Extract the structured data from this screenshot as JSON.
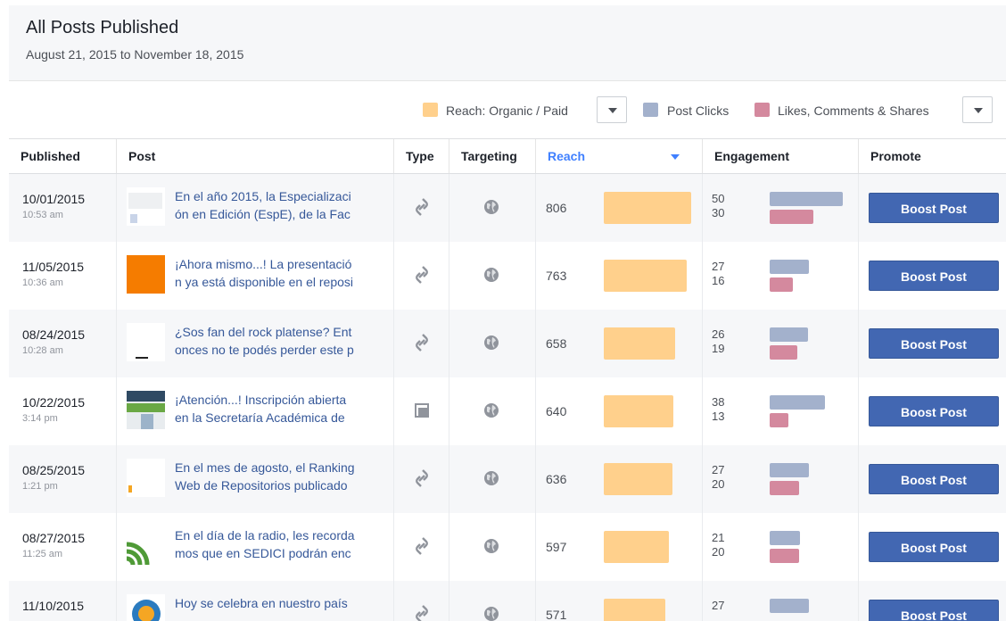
{
  "header": {
    "title": "All Posts Published",
    "date_range": "August 21, 2015 to November 18, 2015"
  },
  "legend": {
    "items": [
      {
        "label": "Reach: Organic / Paid",
        "color": "#ffd08c"
      },
      {
        "label": "Post Clicks",
        "color": "#a3b1cc"
      },
      {
        "label": "Likes, Comments & Shares",
        "color": "#d4899e"
      }
    ]
  },
  "columns": {
    "published": "Published",
    "post": "Post",
    "type": "Type",
    "targeting": "Targeting",
    "reach": "Reach",
    "engagement": "Engagement",
    "promote": "Promote"
  },
  "boost_label": "Boost Post",
  "rows": [
    {
      "date": "10/01/2015",
      "time": "10:53 am",
      "text1": "En el año 2015, la Especializaci",
      "text2": "ón en Edición (EspE), de la Fac",
      "type_icon": "link-icon",
      "reach": 806,
      "clicks": 50,
      "engagement": 30
    },
    {
      "date": "11/05/2015",
      "time": "10:36 am",
      "text1": "¡Ahora mismo...! La presentació",
      "text2": "n ya está disponible en el reposi",
      "type_icon": "link-icon",
      "reach": 763,
      "clicks": 27,
      "engagement": 16
    },
    {
      "date": "08/24/2015",
      "time": "10:28 am",
      "text1": "¿Sos fan del rock platense? Ent",
      "text2": "onces no te podés perder este p",
      "type_icon": "link-icon",
      "reach": 658,
      "clicks": 26,
      "engagement": 19
    },
    {
      "date": "10/22/2015",
      "time": "3:14 pm",
      "text1": "¡Atención...! Inscripción abierta",
      "text2": "en la Secretaría Académica de",
      "type_icon": "album-icon",
      "reach": 640,
      "clicks": 38,
      "engagement": 13
    },
    {
      "date": "08/25/2015",
      "time": "1:21 pm",
      "text1": "En el mes de agosto, el Ranking",
      "text2": "Web de Repositorios publicado",
      "type_icon": "link-icon",
      "reach": 636,
      "clicks": 27,
      "engagement": 20
    },
    {
      "date": "08/27/2015",
      "time": "11:25 am",
      "text1": "En el día de la radio, les recorda",
      "text2": "mos que en SEDICI podrán enc",
      "type_icon": "link-icon",
      "reach": 597,
      "clicks": 21,
      "engagement": 20
    },
    {
      "date": "11/10/2015",
      "time": "",
      "text1": "Hoy se celebra en nuestro país",
      "text2": "",
      "type_icon": "link-icon",
      "reach": 571,
      "clicks": 27,
      "engagement": null
    }
  ]
}
